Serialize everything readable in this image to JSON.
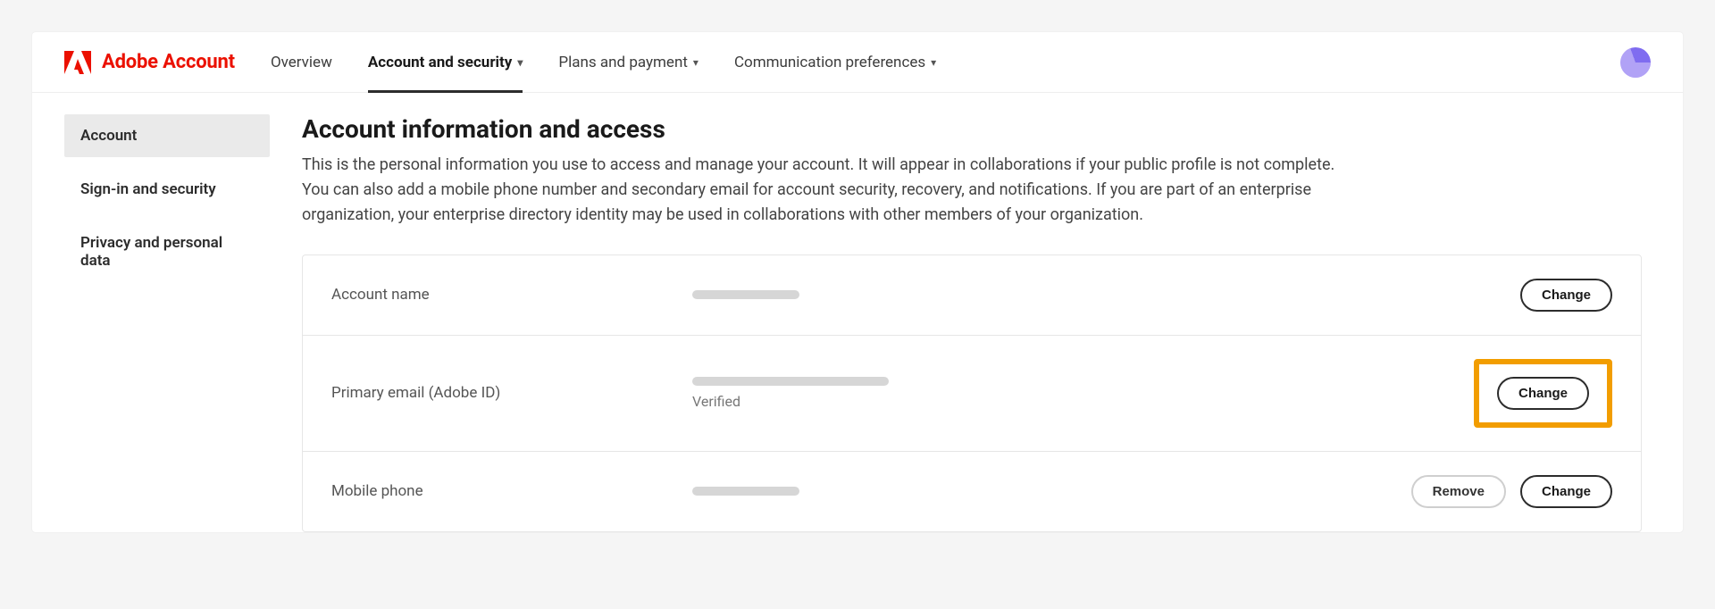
{
  "brand": {
    "text": "Adobe Account"
  },
  "nav": {
    "items": [
      {
        "label": "Overview",
        "has_menu": false,
        "active": false
      },
      {
        "label": "Account and security",
        "has_menu": true,
        "active": true
      },
      {
        "label": "Plans and payment",
        "has_menu": true,
        "active": false
      },
      {
        "label": "Communication preferences",
        "has_menu": true,
        "active": false
      }
    ]
  },
  "sidebar": {
    "items": [
      {
        "label": "Account",
        "active": true
      },
      {
        "label": "Sign-in and security",
        "active": false
      },
      {
        "label": "Privacy and personal data",
        "active": false
      }
    ]
  },
  "main": {
    "heading": "Account information and access",
    "description": "This is the personal information you use to access and manage your account. It will appear in collaborations if your public profile is not complete. You can also add a mobile phone number and secondary email for account security, recovery, and notifications. If you are part of an enterprise organization, your enterprise directory identity may be used in collaborations with other members of your organization."
  },
  "rows": {
    "account_name": {
      "label": "Account name",
      "change": "Change"
    },
    "primary_email": {
      "label": "Primary email (Adobe ID)",
      "status": "Verified",
      "change": "Change"
    },
    "mobile_phone": {
      "label": "Mobile phone",
      "remove": "Remove",
      "change": "Change"
    }
  }
}
